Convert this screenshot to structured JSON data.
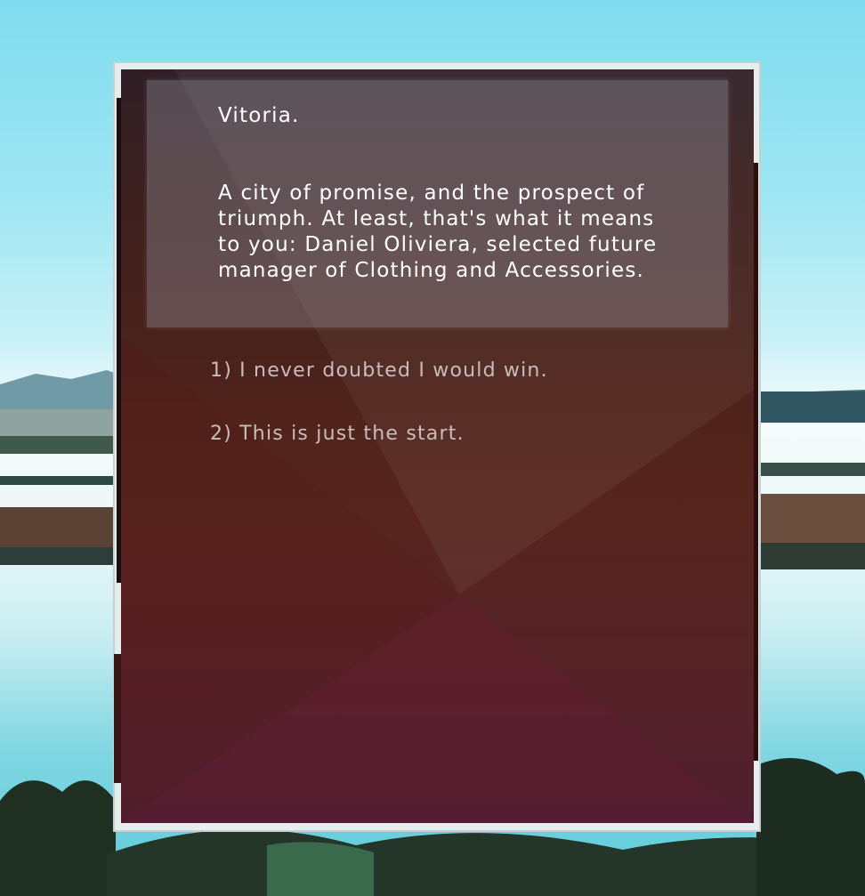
{
  "narration": {
    "location": "Vitoria.",
    "body": "A city of promise, and the prospect of\ntriumph. At least, that's what it means\nto you: Daniel Oliviera, selected future\nmanager of Clothing and Accessories."
  },
  "choices": [
    {
      "label": "1) I never doubted I would win."
    },
    {
      "label": "2) This is just the start."
    }
  ],
  "colors": {
    "panel": "#4f231b",
    "narration_box": "#8a8590",
    "text": "#ffffff",
    "choice_text": "#c9bcbc",
    "sky": "#7fdcee",
    "water": "#5ccbd8"
  }
}
